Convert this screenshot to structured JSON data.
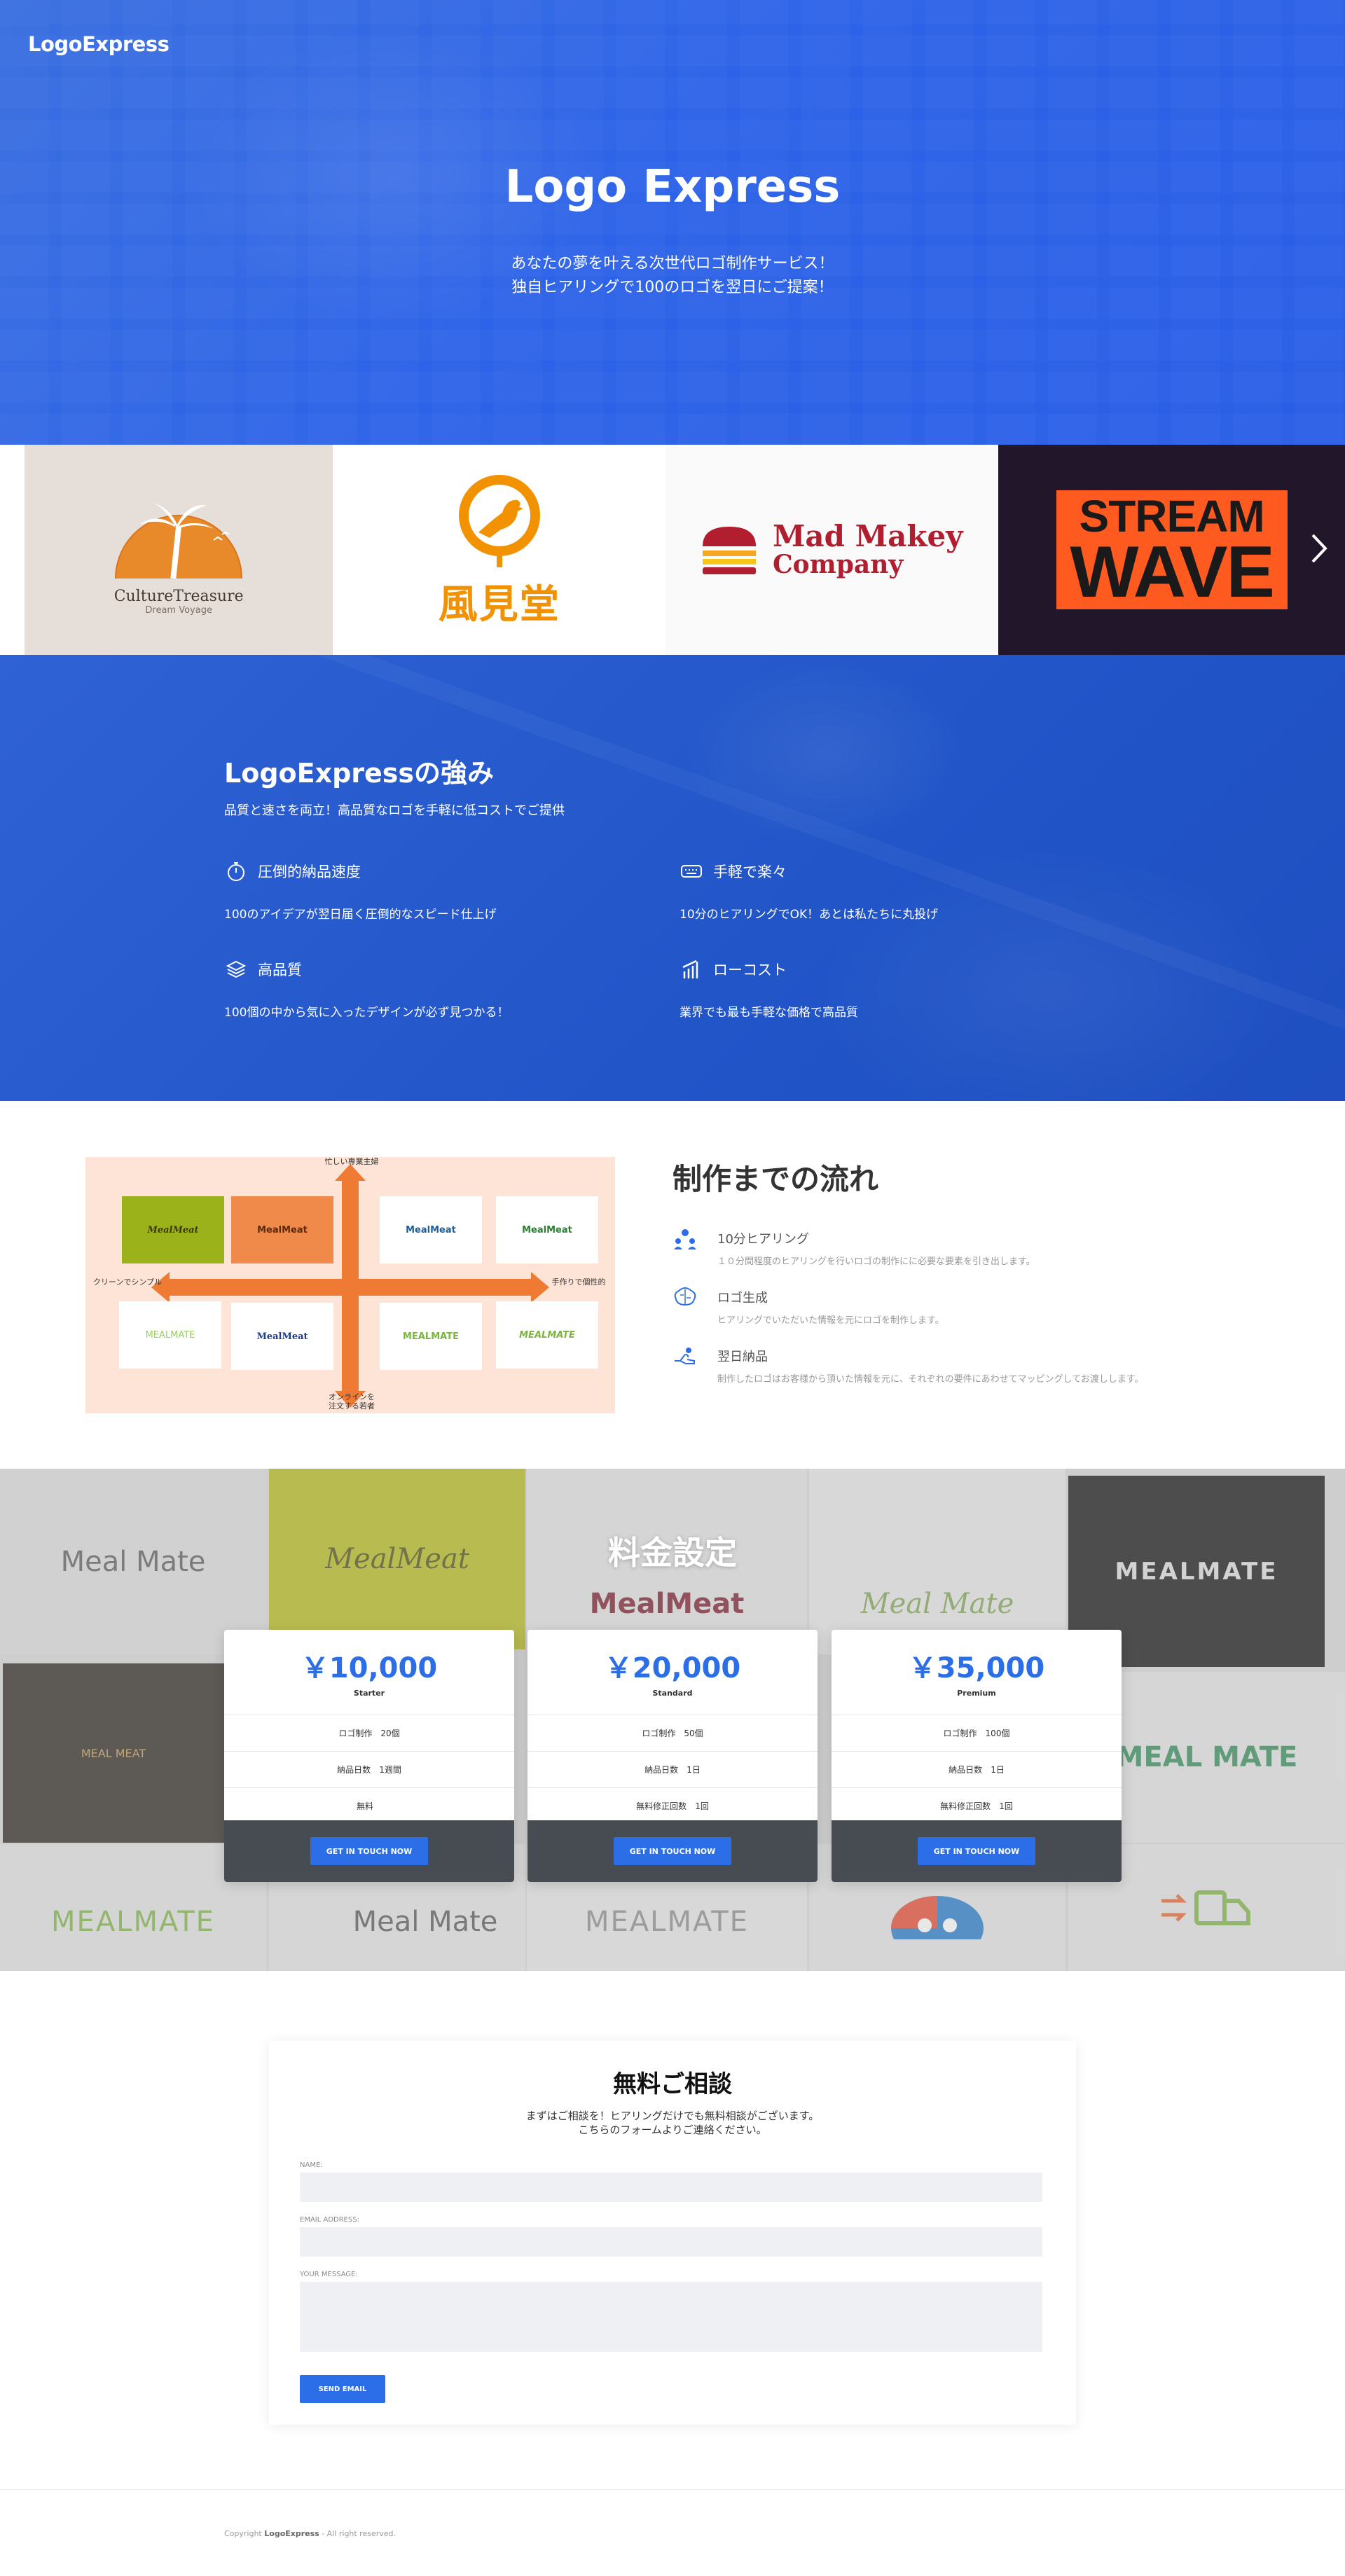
{
  "header": {
    "brand": "LogoExpress"
  },
  "hero": {
    "title": "Logo Express",
    "subtitle_line1": "あなたの夢を叶える次世代ロゴ制作サービス！",
    "subtitle_line2": "独自ヒアリングで100のロゴを翌日にご提案！"
  },
  "logo_strip": {
    "items": [
      {
        "name": "CultureTreasure",
        "tagline": "Dream Voyage"
      },
      {
        "name": "風見堂"
      },
      {
        "name_line1": "Mad Makey",
        "name_line2": "Company"
      },
      {
        "name_line1": "STREAM",
        "name_line2": "WAVE"
      }
    ]
  },
  "strengths": {
    "title": "LogoExpressの強み",
    "subtitle": "品質と速さを両立！高品質なロゴを手軽に低コストでご提供",
    "features": [
      {
        "title": "圧倒的納品速度",
        "desc": "100のアイデアが翌日届く圧倒的なスピード仕上げ",
        "icon": "stopwatch-icon"
      },
      {
        "title": "手軽で楽々",
        "desc": "10分のヒアリングでOK！あとは私たちに丸投げ",
        "icon": "keyboard-icon"
      },
      {
        "title": "高品質",
        "desc": "100個の中から気に入ったデザインが必ず見つかる！",
        "icon": "layers-icon"
      },
      {
        "title": "ローコスト",
        "desc": "業界でも最も手軽な価格で高品質",
        "icon": "bar-chart-icon"
      }
    ]
  },
  "flow": {
    "title": "制作までの流れ",
    "matrix_labels": {
      "top": "忙しい専業主婦",
      "left": "クリーンでシンプル",
      "right": "手作りで個性的",
      "bottom_line1": "オンラインを",
      "bottom_line2": "注文する若者"
    },
    "matrix_cards": [
      "MealMeat",
      "MealMeat",
      "MealMeat",
      "MealMeat",
      "MEALMATE",
      "MealMeat",
      "MEALMATE",
      "MEALMATE"
    ],
    "steps": [
      {
        "title": "10分ヒアリング",
        "desc": "１０分間程度のヒアリングを行いロゴの制作にに必要な要素を引き出します。",
        "icon": "people-icon"
      },
      {
        "title": "ロゴ生成",
        "desc": "ヒアリングでいただいた情報を元にロゴを制作します。",
        "icon": "brain-icon"
      },
      {
        "title": "翌日納品",
        "desc": "制作したロゴはお客様から頂いた情報を元に、それぞれの要件にあわせてマッピングしてお渡しします。",
        "icon": "hand-icon"
      }
    ]
  },
  "pricing": {
    "title": "料金設定",
    "background_logos": [
      "Meal Mate",
      "MealMeat",
      "MealMeat",
      "Meal Mate",
      "MEALMATE",
      "MEAL MEAT",
      "MEAL MATE",
      "MEALMATE",
      "Meal Mate",
      "MEALMATE"
    ],
    "plans": [
      {
        "price": "￥10,000",
        "name": "Starter",
        "rows": [
          [
            "ロゴ制作",
            "20個"
          ],
          [
            "納品日数",
            "1週間"
          ],
          [
            "無料",
            ""
          ]
        ],
        "cta": "GET IN TOUCH NOW"
      },
      {
        "price": "￥20,000",
        "name": "Standard",
        "rows": [
          [
            "ロゴ制作",
            "50個"
          ],
          [
            "納品日数",
            "1日"
          ],
          [
            "無料修正回数",
            "1回"
          ]
        ],
        "cta": "GET IN TOUCH NOW"
      },
      {
        "price": "￥35,000",
        "name": "Premium",
        "rows": [
          [
            "ロゴ制作",
            "100個"
          ],
          [
            "納品日数",
            "1日"
          ],
          [
            "無料修正回数",
            "1回"
          ]
        ],
        "cta": "GET IN TOUCH NOW"
      }
    ]
  },
  "contact": {
    "title": "無料ご相談",
    "desc_line1": "まずはご相談を！ヒアリングだけでも無料相談がございます。",
    "desc_line2": "こちらのフォームよりご連絡ください。",
    "name_label": "NAME:",
    "email_label": "EMAIL ADDRESS:",
    "message_label": "YOUR MESSAGE:",
    "send_label": "SEND EMAIL"
  },
  "footer": {
    "copyright_prefix": "Copyright",
    "copyright_brand": "LogoExpress",
    "copyright_suffix": "- All right reserved."
  },
  "colors": {
    "primary_blue": "#2b6ee8",
    "hero_blue": "#2d63e8",
    "strengths_blue": "#2155c8",
    "accent_orange": "#ee7a33",
    "plan_footer": "#474b52"
  }
}
